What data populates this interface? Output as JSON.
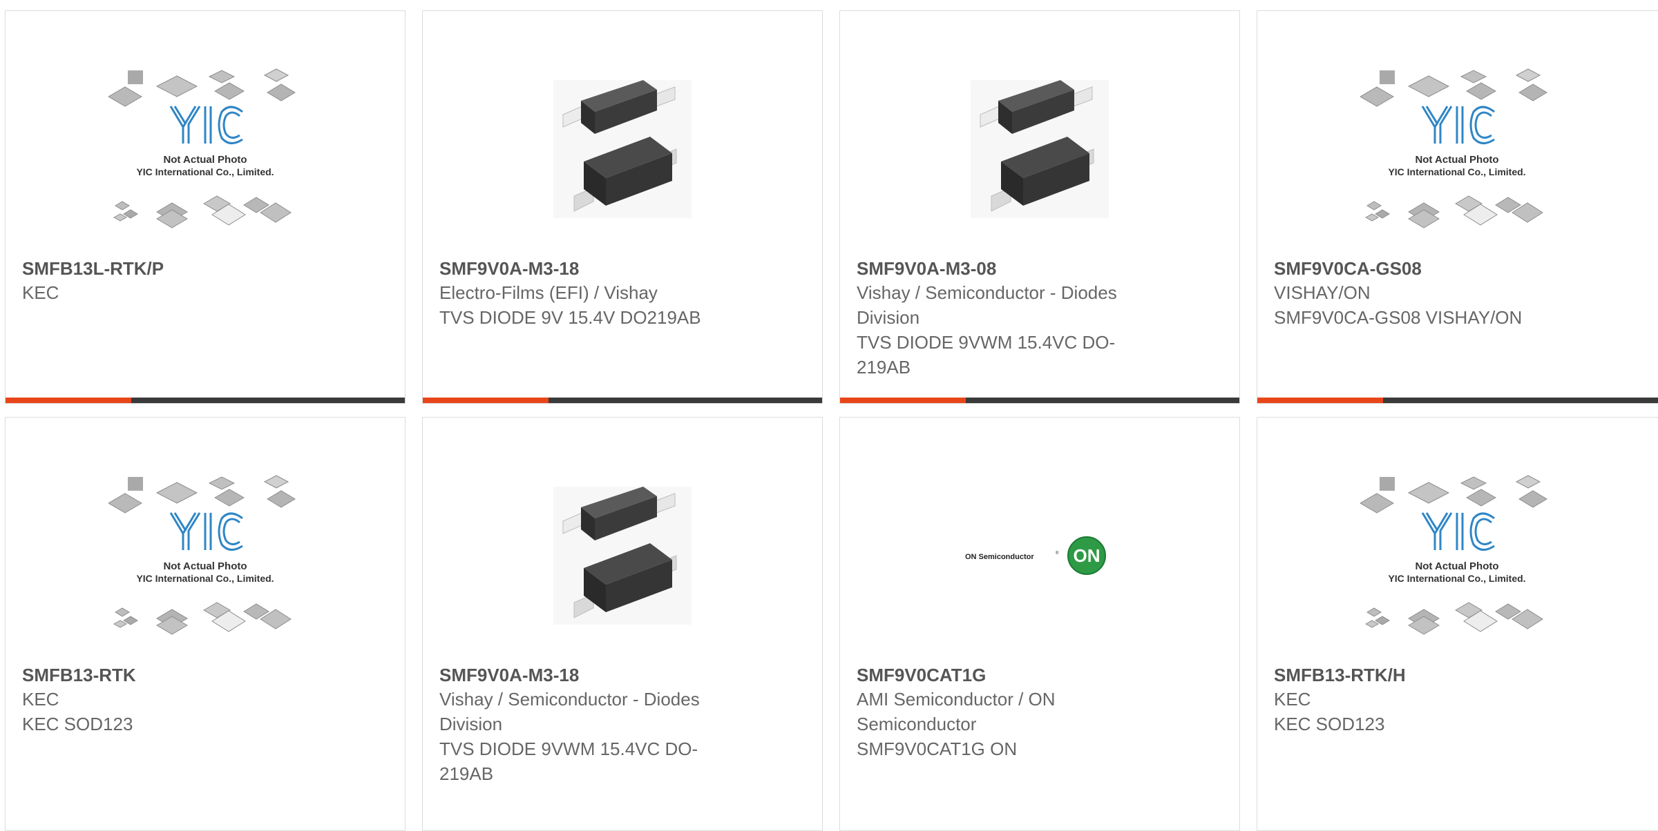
{
  "colors": {
    "accent": "#e8461a",
    "bar": "#3a3a3a",
    "part_text": "#555555",
    "desc_text": "#666666",
    "yic_blue": "#2f86c6",
    "on_green": "#2e9a45"
  },
  "placeholder_texts": {
    "yic_line1": "Not Actual Photo",
    "yic_line2": "YIC International Co., Limited.",
    "on_text": "ON Semiconductor",
    "on_badge": "ON"
  },
  "products": [
    {
      "part": "SMFB13L-RTK/P",
      "manufacturer": "KEC",
      "description": "",
      "image": "yic-placeholder-icon"
    },
    {
      "part": "SMF9V0A-M3-18",
      "manufacturer": "Electro-Films (EFI) / Vishay",
      "description": "TVS DIODE 9V 15.4V DO219AB",
      "image": "diode-package-icon"
    },
    {
      "part": "SMF9V0A-M3-08",
      "manufacturer": "Vishay / Semiconductor - Diodes Division",
      "description": "TVS DIODE 9VWM 15.4VC DO-219AB",
      "image": "diode-package-icon"
    },
    {
      "part": "SMF9V0CA-GS08",
      "manufacturer": "VISHAY/ON",
      "description": "SMF9V0CA-GS08 VISHAY/ON",
      "image": "yic-placeholder-icon"
    },
    {
      "part": "SMFB13-RTK",
      "manufacturer": "KEC",
      "description": "KEC SOD123",
      "image": "yic-placeholder-icon"
    },
    {
      "part": "SMF9V0A-M3-18",
      "manufacturer": "Vishay / Semiconductor - Diodes Division",
      "description": "TVS DIODE 9VWM 15.4VC DO-219AB",
      "image": "diode-package-icon"
    },
    {
      "part": "SMF9V0CAT1G",
      "manufacturer": "AMI Semiconductor / ON Semiconductor",
      "description": "SMF9V0CAT1G ON",
      "image": "on-semi-logo-icon"
    },
    {
      "part": "SMFB13-RTK/H",
      "manufacturer": "KEC",
      "description": "KEC SOD123",
      "image": "yic-placeholder-icon"
    }
  ]
}
